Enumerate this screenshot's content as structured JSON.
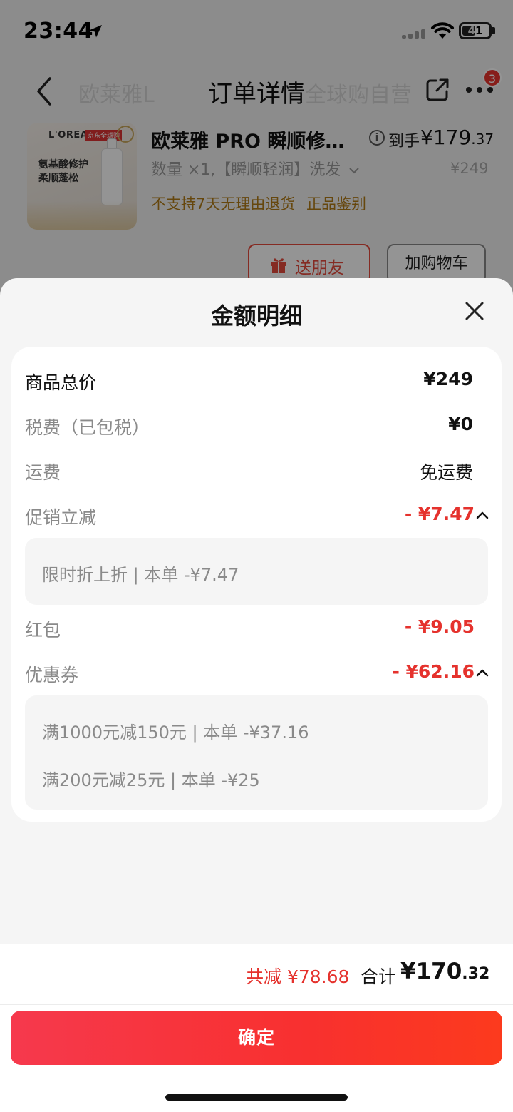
{
  "status_bar": {
    "time": "23:44",
    "battery": "41"
  },
  "nav": {
    "title": "订单详情",
    "faded_left": "欧莱雅L",
    "faded_right": "全球购自营",
    "badge_count": "3"
  },
  "product": {
    "brand": "L'OREAL",
    "img_tag": "京东全球购",
    "img_text": "氨基酸修护柔顺蓬松",
    "name": "欧莱雅 PRO 瞬顺修…",
    "price_label": "到手",
    "price_int": "¥179",
    "price_dec": ".37",
    "spec": "数量 ×1,【瞬顺轻润】洗发",
    "original_price": "¥249",
    "policy": "不支持7天无理由退货",
    "authenticity": "正品鉴别",
    "gift_button": "送朋友",
    "cart_button": "加购物车"
  },
  "sheet": {
    "title": "金额明细",
    "rows": {
      "goods_total": {
        "label": "商品总价",
        "value": "¥249"
      },
      "tax": {
        "label": "税费（已包税）",
        "value": "¥0"
      },
      "shipping": {
        "label": "运费",
        "value": "免运费"
      },
      "promotion": {
        "label": "促销立减",
        "value": "- ¥7.47",
        "details": [
          "限时折上折 | 本单 -¥7.47"
        ]
      },
      "red_packet": {
        "label": "红包",
        "value": "- ¥9.05"
      },
      "coupon": {
        "label": "优惠券",
        "value": "- ¥62.16",
        "details": [
          "满1000元减150元 | 本单 -¥37.16",
          "满200元减25元 | 本单 -¥25"
        ]
      }
    }
  },
  "footer": {
    "total_reduce": "共减 ¥78.68",
    "total_label": "合计",
    "total_int": "¥170",
    "total_dec": ".32",
    "confirm_button": "确定"
  },
  "colors": {
    "accent_red": "#e5322d",
    "button_gradient_start": "#f6394d",
    "button_gradient_end": "#fc3a1d",
    "policy_gold": "#b07a18"
  }
}
